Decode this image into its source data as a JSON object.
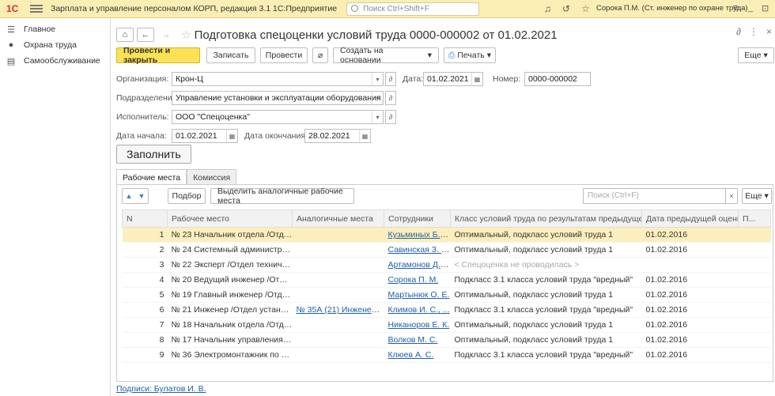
{
  "topbar": {
    "logo": "1С",
    "title": "Зарплата и управление персоналом КОРП, редакция 3.1 1С:Предприятие",
    "search_placeholder": "Поиск Ctrl+Shift+F",
    "user": "Сорока П.М. (Ст. инженер по охране труда)"
  },
  "sidebar": {
    "items": [
      {
        "label": "Главное",
        "icon": "menu-icon"
      },
      {
        "label": "Охрана труда",
        "icon": "bulb-icon"
      },
      {
        "label": "Самообслуживание",
        "icon": "card-icon"
      }
    ]
  },
  "document": {
    "title": "Подготовка спецоценки условий труда 0000-000002 от 01.02.2021"
  },
  "toolbar": {
    "post_close": "Провести и закрыть",
    "save": "Записать",
    "post": "Провести",
    "create_based": "Создать на основании",
    "print": "Печать",
    "more": "Еще"
  },
  "form": {
    "org_label": "Организация:",
    "org_value": "Крон-Ц",
    "date_label": "Дата:",
    "date_value": "01.02.2021",
    "number_label": "Номер:",
    "number_value": "0000-000002",
    "dept_label": "Подразделение:",
    "dept_value": "Управление установки и эксплуатации оборудования",
    "executor_label": "Исполнитель:",
    "executor_value": "ООО \"Спецоценка\"",
    "start_label": "Дата начала:",
    "start_value": "01.02.2021",
    "end_label": "Дата окончания:",
    "end_value": "28.02.2021"
  },
  "fill_button": "Заполнить",
  "tabs": [
    {
      "label": "Рабочие места",
      "active": true
    },
    {
      "label": "Комиссия",
      "active": false
    }
  ],
  "panel": {
    "select_btn": "Подбор",
    "similar_btn": "Выделить аналогичные рабочие места",
    "search_placeholder": "Поиск (Ctrl+F)",
    "more": "Еще"
  },
  "table": {
    "headers": [
      "N",
      "Рабочее место",
      "Аналогичные места",
      "Сотрудники",
      "Класс условий труда по результатам предыдущей ...",
      "Дата предыдущей оценки",
      "П..."
    ],
    "rows": [
      {
        "n": "1",
        "place": "№ 23 Начальник отдела /Отдел...",
        "similar": "",
        "employee": "Кузьминых Б. С.",
        "class": "Оптимальный, подкласс условий труда 1",
        "date": "01.02.2016",
        "selected": true
      },
      {
        "n": "2",
        "place": "№ 24 Системный администрато...",
        "similar": "",
        "employee": "Савинская З. Ю.",
        "class": "Оптимальный, подкласс условий труда 1",
        "date": "01.02.2016"
      },
      {
        "n": "3",
        "place": "№ 22 Эксперт /Отдел техничес...",
        "similar": "",
        "employee": "Артамонов Д. С.",
        "class": "< Спецоценка не проводилась >",
        "date": "",
        "muted": true
      },
      {
        "n": "4",
        "place": "№ 20 Ведущий инженер /Отде...",
        "similar": "",
        "employee": "Сорока П. М.",
        "class": "Подкласс 3.1 класса условий труда \"вредный\"",
        "date": "01.02.2016"
      },
      {
        "n": "5",
        "place": "№ 19 Главный инженер /Отдел ...",
        "similar": "",
        "employee": "Мартынюк О. Е.",
        "class": "Оптимальный, подкласс условий труда 1",
        "date": "01.02.2016"
      },
      {
        "n": "6",
        "place": "№ 21 Инженер /Отдел установк...",
        "similar": "№ 35А (21) Инженер /...",
        "employee": "Климов И. С., ...",
        "class": "Подкласс 3.1 класса условий труда \"вредный\"",
        "date": "01.02.2016"
      },
      {
        "n": "7",
        "place": "№ 18 Начальник отдела /Отдел...",
        "similar": "",
        "employee": "Никаноров Е. К.",
        "class": "Оптимальный, подкласс условий труда 1",
        "date": "01.02.2016"
      },
      {
        "n": "8",
        "place": "№ 17 Начальник управления /У...",
        "similar": "",
        "employee": "Волков М. С.",
        "class": "Оптимальный, подкласс условий труда 1",
        "date": "01.02.2016"
      },
      {
        "n": "9",
        "place": "№ 36 Электромонтажник по акк...",
        "similar": "",
        "employee": "Клюев А. С.",
        "class": "Подкласс 3.1 класса условий труда \"вредный\"",
        "date": "01.02.2016"
      }
    ]
  },
  "footer": {
    "signatures": "Подписи: Булатов И. В."
  },
  "colors": {
    "topbar": "#fbeeb4",
    "primary_button": "#fbe254",
    "selected_row": "#fcefbd",
    "link": "#1f5fa8"
  }
}
